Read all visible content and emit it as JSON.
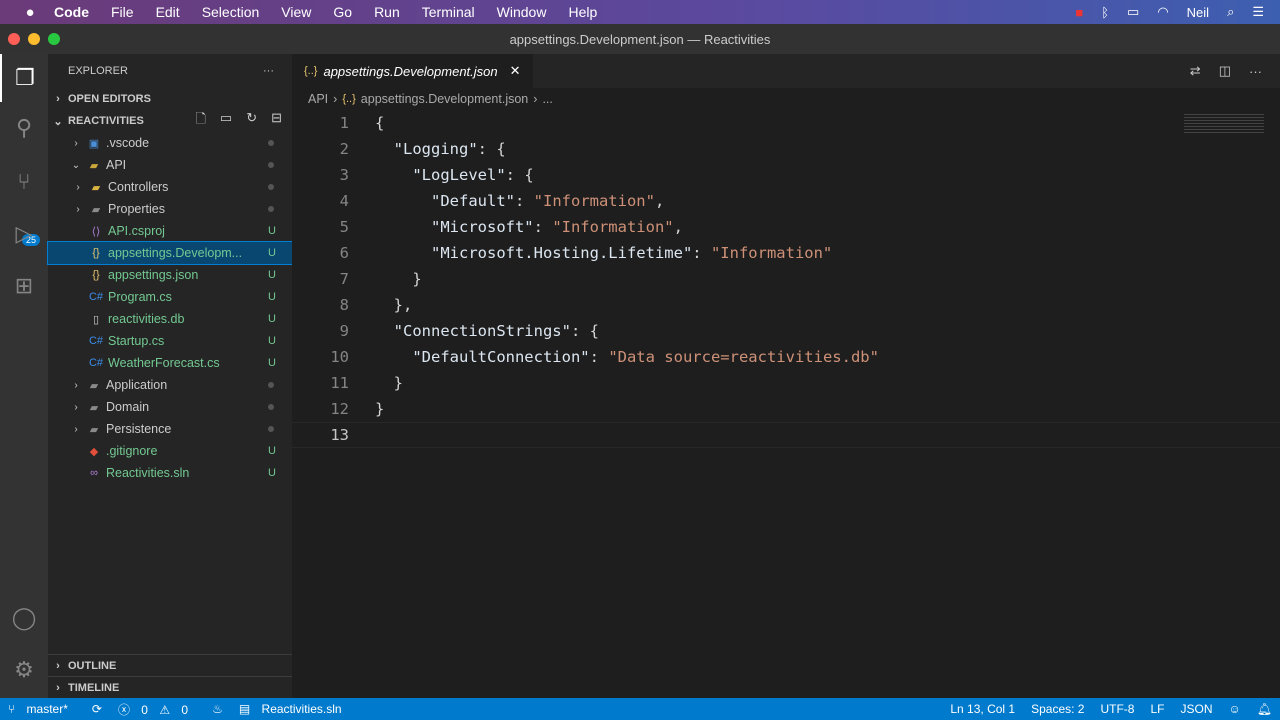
{
  "menubar": {
    "items": [
      "Code",
      "File",
      "Edit",
      "Selection",
      "View",
      "Go",
      "Run",
      "Terminal",
      "Window",
      "Help"
    ],
    "user": "Neil"
  },
  "window": {
    "title": "appsettings.Development.json — Reactivities"
  },
  "activity": {
    "scm_badge": "25"
  },
  "sidebar": {
    "title": "EXPLORER",
    "more": "···",
    "open_editors": "OPEN EDITORS",
    "project": "REACTIVITIES",
    "outline": "OUTLINE",
    "timeline": "TIMELINE",
    "tree": [
      {
        "label": ".vscode",
        "status": ""
      },
      {
        "label": "API",
        "status": ""
      },
      {
        "label": "Controllers",
        "status": ""
      },
      {
        "label": "Properties",
        "status": ""
      },
      {
        "label": "API.csproj",
        "status": "U"
      },
      {
        "label": "appsettings.Developm...",
        "status": "U"
      },
      {
        "label": "appsettings.json",
        "status": "U"
      },
      {
        "label": "Program.cs",
        "status": "U"
      },
      {
        "label": "reactivities.db",
        "status": "U"
      },
      {
        "label": "Startup.cs",
        "status": "U"
      },
      {
        "label": "WeatherForecast.cs",
        "status": "U"
      },
      {
        "label": "Application",
        "status": ""
      },
      {
        "label": "Domain",
        "status": ""
      },
      {
        "label": "Persistence",
        "status": ""
      },
      {
        "label": ".gitignore",
        "status": "U"
      },
      {
        "label": "Reactivities.sln",
        "status": "U"
      }
    ]
  },
  "editor": {
    "tab": "appsettings.Development.json",
    "breadcrumb": [
      "API",
      "appsettings.Development.json",
      "..."
    ],
    "lines": [
      [
        [
          "p",
          "{"
        ]
      ],
      [
        [
          "k",
          "  \"Logging\""
        ],
        [
          "p",
          ": {"
        ]
      ],
      [
        [
          "k",
          "    \"LogLevel\""
        ],
        [
          "p",
          ": {"
        ]
      ],
      [
        [
          "k",
          "      \"Default\""
        ],
        [
          "p",
          ": "
        ],
        [
          "s",
          "\"Information\""
        ],
        [
          "p",
          ","
        ]
      ],
      [
        [
          "k",
          "      \"Microsoft\""
        ],
        [
          "p",
          ": "
        ],
        [
          "s",
          "\"Information\""
        ],
        [
          "p",
          ","
        ]
      ],
      [
        [
          "k",
          "      \"Microsoft.Hosting.Lifetime\""
        ],
        [
          "p",
          ": "
        ],
        [
          "s",
          "\"Information\""
        ]
      ],
      [
        [
          "p",
          "    }"
        ]
      ],
      [
        [
          "p",
          "  },"
        ]
      ],
      [
        [
          "k",
          "  \"ConnectionStrings\""
        ],
        [
          "p",
          ": {"
        ]
      ],
      [
        [
          "k",
          "    \"DefaultConnection\""
        ],
        [
          "p",
          ": "
        ],
        [
          "s",
          "\"Data source=reactivities.db\""
        ]
      ],
      [
        [
          "p",
          "  }"
        ]
      ],
      [
        [
          "p",
          "}"
        ]
      ],
      [
        [
          "p",
          ""
        ]
      ]
    ]
  },
  "status": {
    "branch": "master*",
    "errors": "0",
    "warnings": "0",
    "solution": "Reactivities.sln",
    "position": "Ln 13, Col 1",
    "spaces": "Spaces: 2",
    "encoding": "UTF-8",
    "eol": "LF",
    "language": "JSON"
  }
}
